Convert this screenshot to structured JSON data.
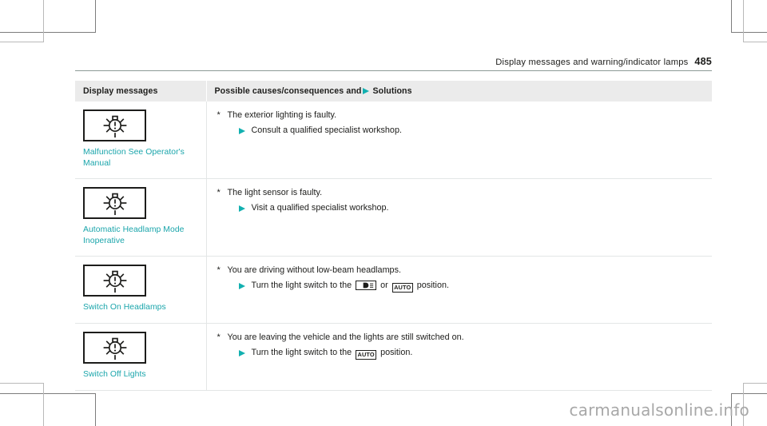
{
  "running_header": {
    "title": "Display messages and warning/indicator lamps",
    "page_number": "485"
  },
  "table": {
    "headers": {
      "col1": "Display messages",
      "col2_before": "Possible causes/consequences and",
      "col2_after": "Solutions",
      "solutions_arrow_icon": "triangle-right-icon"
    },
    "rows": [
      {
        "symbol_icon": "bulb-warning-icon",
        "symbol_label": "Malfunction See Operator's Manual",
        "cause_bullet": "*",
        "cause": "The exterior lighting is faulty.",
        "solution_arrow_icon": "triangle-right-icon",
        "solution_parts": [
          {
            "type": "text",
            "value": "Consult a qualified specialist workshop."
          }
        ]
      },
      {
        "symbol_icon": "bulb-warning-icon",
        "symbol_label": "Automatic Headlamp Mode Inoperative",
        "cause_bullet": "*",
        "cause": "The light sensor is faulty.",
        "solution_arrow_icon": "triangle-right-icon",
        "solution_parts": [
          {
            "type": "text",
            "value": "Visit a qualified specialist workshop."
          }
        ]
      },
      {
        "symbol_icon": "bulb-warning-icon",
        "symbol_label": "Switch On Headlamps",
        "cause_bullet": "*",
        "cause": "You are driving without low-beam headlamps.",
        "solution_arrow_icon": "triangle-right-icon",
        "solution_parts": [
          {
            "type": "text",
            "value": "Turn the light switch to the "
          },
          {
            "type": "icon",
            "icon": "low-beam-headlamp-icon",
            "value": ""
          },
          {
            "type": "text",
            "value": " or "
          },
          {
            "type": "icon",
            "icon": "auto-light-icon",
            "value": "AUTO"
          },
          {
            "type": "text",
            "value": " position."
          }
        ]
      },
      {
        "symbol_icon": "bulb-warning-icon",
        "symbol_label": "Switch Off Lights",
        "cause_bullet": "*",
        "cause": "You are leaving the vehicle and the lights are still switched on.",
        "solution_arrow_icon": "triangle-right-icon",
        "solution_parts": [
          {
            "type": "text",
            "value": "Turn the light switch to the "
          },
          {
            "type": "icon",
            "icon": "auto-light-icon",
            "value": "AUTO"
          },
          {
            "type": "text",
            "value": " position."
          }
        ]
      }
    ]
  },
  "watermark": "carmanualsonline.info",
  "colors": {
    "accent_teal": "#12b0b0",
    "label_teal": "#1aa5ab",
    "header_band": "#ebebeb",
    "rule": "#8c9a96",
    "text": "#1d1d1b",
    "watermark": "#a8a8a8"
  }
}
